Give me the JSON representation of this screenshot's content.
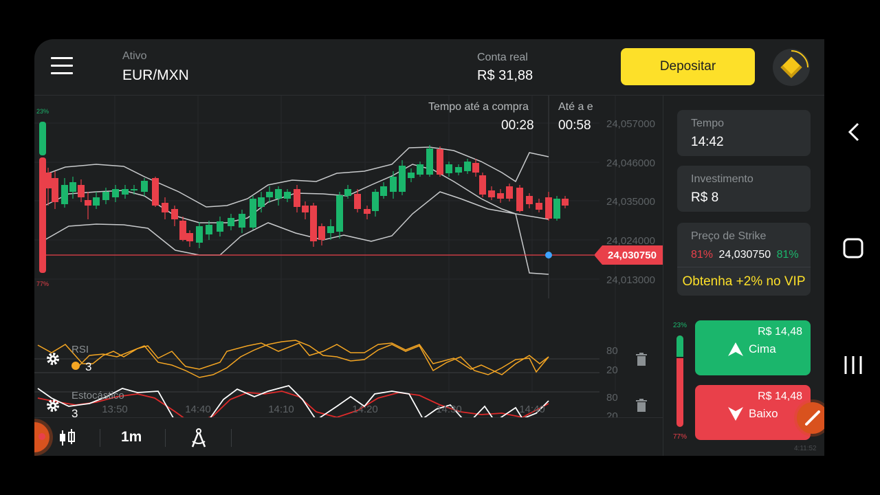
{
  "header": {
    "asset_label": "Ativo",
    "asset_name": "EUR/MXN",
    "account_label": "Conta real",
    "account_balance": "R$ 31,88",
    "deposit_label": "Depositar"
  },
  "chart": {
    "timer_buy_label": "Tempo até a compra",
    "timer_buy_value": "00:28",
    "timer_exp_label": "Até a e",
    "timer_exp_value": "00:58",
    "price_ticks": [
      "24,057000",
      "24,046000",
      "24,035000",
      "24,024000",
      "24,013000"
    ],
    "current_price": "24,030750",
    "up_pct": "23%",
    "down_pct": "77%",
    "time_ticks": [
      "13:50",
      "14:40",
      "14:10",
      "14:20",
      "14:30",
      "14:40"
    ],
    "colors": {
      "up": "#1bb66c",
      "down": "#e9404a",
      "rsi": "#f5a623",
      "band": "#c9cbcd",
      "price_line": "#e9404a"
    }
  },
  "indicators": {
    "rsi": {
      "name": "RSI",
      "period": "3",
      "levels": [
        "80",
        "20"
      ]
    },
    "stoch": {
      "name": "Estocástico",
      "period": "3",
      "levels": [
        "80",
        "20"
      ]
    }
  },
  "toolbar": {
    "timeframe": "1m"
  },
  "sidebar": {
    "time_label": "Tempo",
    "time_value": "14:42",
    "investment_label": "Investimento",
    "investment_value": "R$ 8",
    "strike_label": "Preço de Strike",
    "strike_low_pct": "81%",
    "strike_value": "24,030750",
    "strike_high_pct": "81%",
    "vip_label": "Obtenha +2% no VIP",
    "sentiment_up": "23%",
    "sentiment_down": "77%",
    "up_button": {
      "amount": "R$ 14,48",
      "label": "Cima"
    },
    "down_button": {
      "amount": "R$ 14,48",
      "label": "Baixo"
    },
    "footer_time": "4:11:52"
  }
}
